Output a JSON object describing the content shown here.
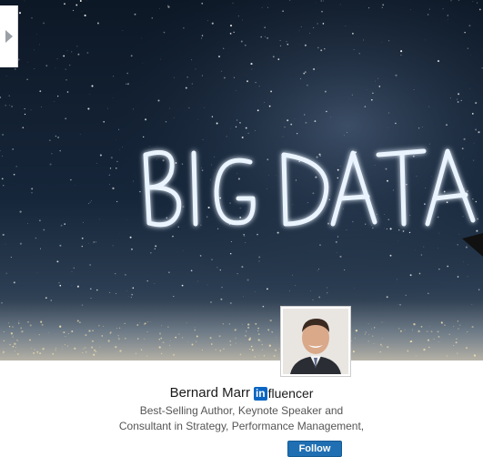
{
  "hero": {
    "banner_text": "BIG DATA",
    "nav_icon": "chevron-right-icon"
  },
  "profile": {
    "name": "Bernard Marr",
    "badge_in": "in",
    "badge_rest": "fluencer",
    "headline_line1": "Best-Selling Author, Keynote Speaker and",
    "headline_line2": "Consultant in Strategy, Performance Management,",
    "follow_label": "Follow"
  },
  "colors": {
    "brand": "#0a66c2",
    "follow_button": "#1f6fb2"
  }
}
